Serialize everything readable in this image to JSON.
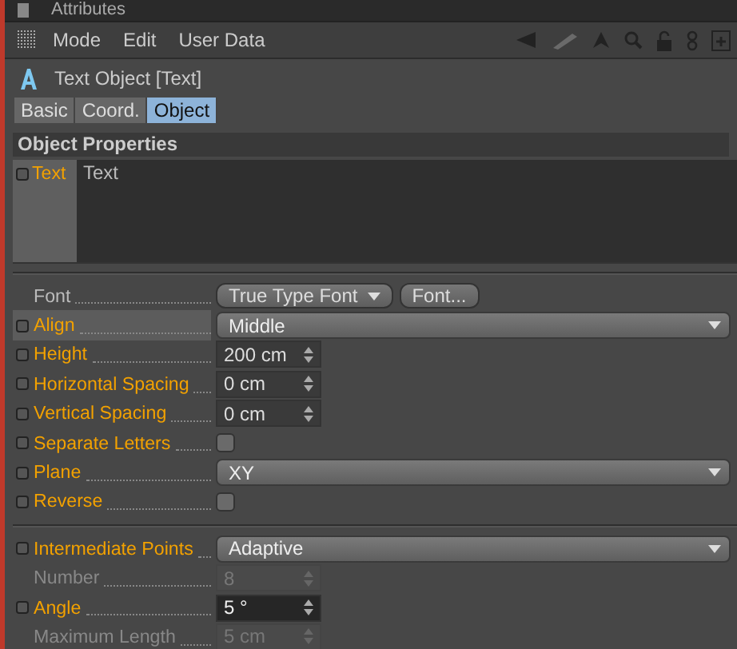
{
  "window": {
    "title": "Attributes"
  },
  "menu": [
    "Mode",
    "Edit",
    "User Data"
  ],
  "object": {
    "title": "Text Object [Text]"
  },
  "tabs": [
    {
      "label": "Basic",
      "selected": false
    },
    {
      "label": "Coord.",
      "selected": false
    },
    {
      "label": "Object",
      "selected": true
    }
  ],
  "section": {
    "title": "Object Properties"
  },
  "text_field": {
    "label": "Text",
    "value": "Text",
    "selected": true
  },
  "groups": [
    [
      {
        "label": "Font",
        "kind": "font",
        "value": "True Type Font",
        "button": "Font...",
        "animatable": false,
        "disabled": false,
        "selected": false
      },
      {
        "label": "Align",
        "kind": "select",
        "value": "Middle",
        "animatable": true,
        "disabled": false,
        "selected": true
      },
      {
        "label": "Height",
        "kind": "number",
        "value": "200 cm",
        "animatable": true,
        "disabled": false,
        "selected": false,
        "focused": false
      },
      {
        "label": "Horizontal Spacing",
        "kind": "number",
        "value": "0 cm",
        "animatable": true,
        "disabled": false,
        "selected": false,
        "focused": false
      },
      {
        "label": "Vertical Spacing",
        "kind": "number",
        "value": "0 cm",
        "animatable": true,
        "disabled": false,
        "selected": false,
        "focused": false
      },
      {
        "label": "Separate Letters",
        "kind": "checkbox",
        "checked": false,
        "animatable": true,
        "disabled": false,
        "selected": false
      },
      {
        "label": "Plane",
        "kind": "select",
        "value": "XY",
        "animatable": true,
        "disabled": false,
        "selected": false
      },
      {
        "label": "Reverse",
        "kind": "checkbox",
        "checked": false,
        "animatable": true,
        "disabled": false,
        "selected": false
      }
    ],
    [
      {
        "label": "Intermediate Points",
        "kind": "select",
        "value": "Adaptive",
        "animatable": true,
        "disabled": false,
        "selected": false
      },
      {
        "label": "Number",
        "kind": "number",
        "value": "8",
        "animatable": false,
        "disabled": true,
        "selected": false,
        "focused": false
      },
      {
        "label": "Angle",
        "kind": "number",
        "value": "5 °",
        "animatable": true,
        "disabled": false,
        "selected": false,
        "focused": true
      },
      {
        "label": "Maximum Length",
        "kind": "number",
        "value": "5 cm",
        "animatable": false,
        "disabled": true,
        "selected": false,
        "focused": false
      }
    ]
  ]
}
